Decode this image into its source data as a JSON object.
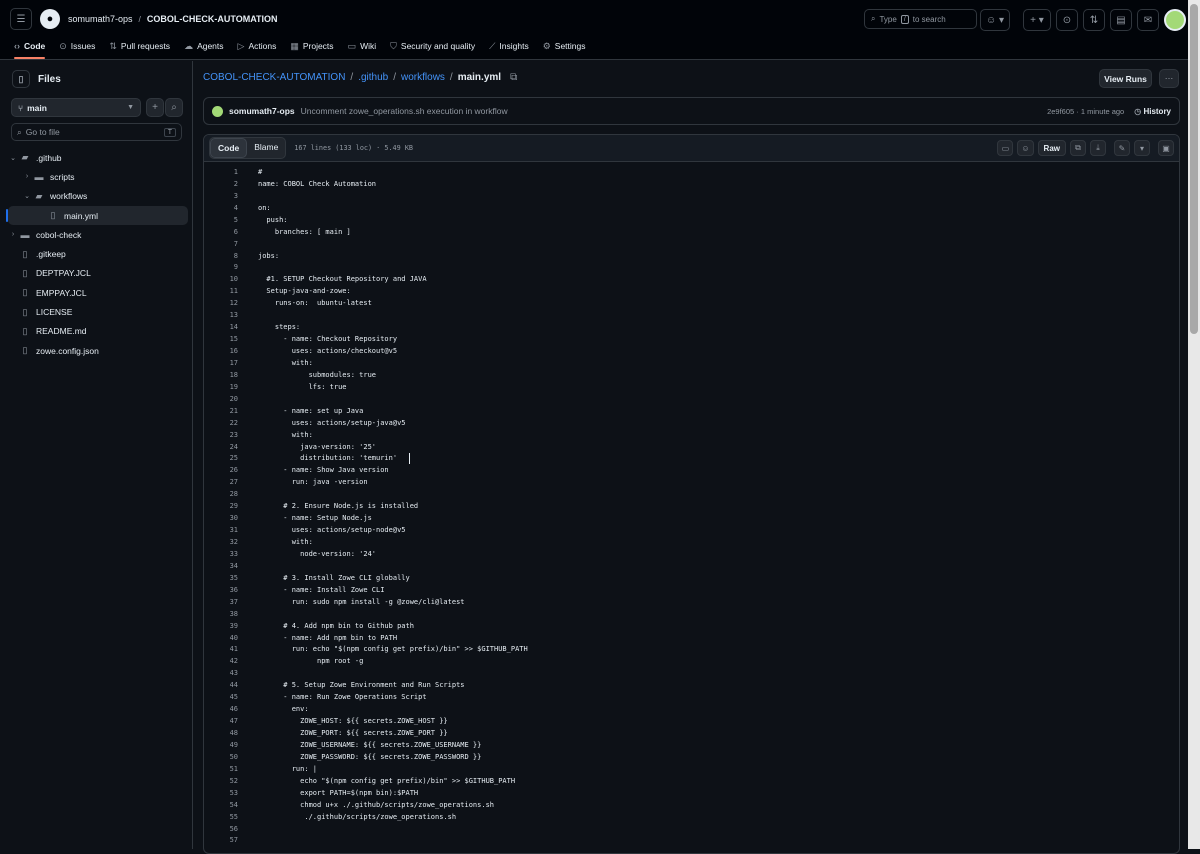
{
  "header": {
    "owner": "somumath7-ops",
    "repo": "COBOL-CHECK-AUTOMATION",
    "search_prefix": "Type",
    "search_key": "/",
    "search_suffix": "to search"
  },
  "repo_tabs": [
    {
      "label": "Code",
      "icon": "code-icon"
    },
    {
      "label": "Issues",
      "icon": "issue-icon"
    },
    {
      "label": "Pull requests",
      "icon": "pull-request-icon"
    },
    {
      "label": "Agents",
      "icon": "agent-icon"
    },
    {
      "label": "Actions",
      "icon": "play-icon"
    },
    {
      "label": "Projects",
      "icon": "table-icon"
    },
    {
      "label": "Wiki",
      "icon": "book-icon"
    },
    {
      "label": "Security and quality",
      "icon": "shield-icon"
    },
    {
      "label": "Insights",
      "icon": "graph-icon"
    },
    {
      "label": "Settings",
      "icon": "gear-icon"
    }
  ],
  "sidebar": {
    "title": "Files",
    "branch": "main",
    "goto_placeholder": "Go to file",
    "goto_key": "T",
    "tree": [
      {
        "label": ".github",
        "type": "folder",
        "expanded": true,
        "depth": 0
      },
      {
        "label": "scripts",
        "type": "folder",
        "expanded": false,
        "depth": 1
      },
      {
        "label": "workflows",
        "type": "folder",
        "expanded": true,
        "depth": 1
      },
      {
        "label": "main.yml",
        "type": "file",
        "depth": 2,
        "selected": true
      },
      {
        "label": "cobol-check",
        "type": "folder",
        "expanded": false,
        "depth": 0
      },
      {
        "label": ".gitkeep",
        "type": "file",
        "depth": 0
      },
      {
        "label": "DEPTPAY.JCL",
        "type": "file",
        "depth": 0
      },
      {
        "label": "EMPPAY.JCL",
        "type": "file",
        "depth": 0
      },
      {
        "label": "LICENSE",
        "type": "file",
        "depth": 0
      },
      {
        "label": "README.md",
        "type": "file",
        "depth": 0
      },
      {
        "label": "zowe.config.json",
        "type": "file",
        "depth": 0
      }
    ]
  },
  "breadcrumb": {
    "parts": [
      "COBOL-CHECK-AUTOMATION",
      ".github",
      "workflows"
    ],
    "current": "main.yml",
    "view_runs": "View Runs"
  },
  "commit": {
    "author": "somumath7-ops",
    "message": "Uncomment zowe_operations.sh execution in workflow",
    "sha_time": "2e9f605 · 1 minute ago",
    "history": "History"
  },
  "file": {
    "tab_code": "Code",
    "tab_blame": "Blame",
    "info": "167 lines (133 loc) · 5.49 KB",
    "raw_label": "Raw"
  },
  "code_lines": [
    "#",
    "name: COBOL Check Automation",
    "",
    "on:",
    "  push:",
    "    branches: [ main ]",
    "",
    "jobs:",
    "",
    "  #1. SETUP Checkout Repository and JAVA",
    "  Setup-java-and-zowe:",
    "    runs-on:  ubuntu-latest",
    "",
    "    steps:",
    "      - name: Checkout Repository",
    "        uses: actions/checkout@v5",
    "        with:",
    "            submodules: true",
    "            lfs: true",
    "",
    "      - name: set up Java",
    "        uses: actions/setup-java@v5",
    "        with:",
    "          java-version: '25'",
    "          distribution: 'temurin'",
    "      - name: Show Java version",
    "        run: java -version",
    "",
    "      # 2. Ensure Node.js is installed",
    "      - name: Setup Node.js",
    "        uses: actions/setup-node@v5",
    "        with:",
    "          node-version: '24'",
    "",
    "      # 3. Install Zowe CLI globally",
    "      - name: Install Zowe CLI",
    "        run: sudo npm install -g @zowe/cli@latest",
    "",
    "      # 4. Add npm bin to Github path",
    "      - name: Add npm bin to PATH",
    "        run: echo \"$(npm config get prefix)/bin\" >> $GITHUB_PATH",
    "              npm root -g",
    "",
    "      # 5. Setup Zowe Environment and Run Scripts",
    "      - name: Run Zowe Operations Script",
    "        env:",
    "          ZOWE_HOST: ${{ secrets.ZOWE_HOST }}",
    "          ZOWE_PORT: ${{ secrets.ZOWE_PORT }}",
    "          ZOWE_USERNAME: ${{ secrets.ZOWE_USERNAME }}",
    "          ZOWE_PASSWORD: ${{ secrets.ZOWE_PASSWORD }}",
    "        run: |",
    "          echo \"$(npm config get prefix)/bin\" >> $GITHUB_PATH",
    "          export PATH=$(npm bin):$PATH",
    "          chmod u+x ./.github/scripts/zowe_operations.sh",
    "           ./.github/scripts/zowe_operations.sh",
    "",
    ""
  ],
  "colors": {
    "bg": "#0d1117",
    "accent_link": "#4493f8",
    "tab_underline": "#f78166",
    "selection_bar": "#1f6feb"
  }
}
